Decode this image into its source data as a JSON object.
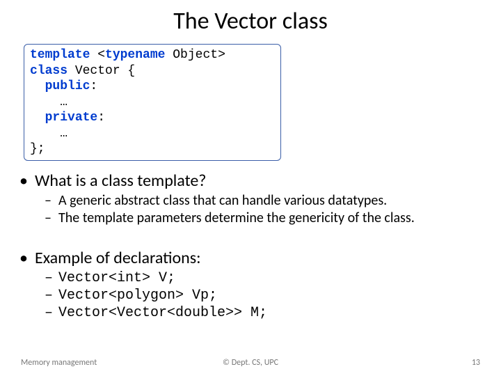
{
  "title": "The Vector class",
  "code": {
    "l1a": "template",
    "l1b": " <",
    "l1c": "typename",
    "l1d": " Object>",
    "l2a": "class",
    "l2b": " Vector {",
    "l3a": "  ",
    "l3b": "public",
    "l3c": ":",
    "l4": "    …",
    "l5a": "  ",
    "l5b": "private",
    "l5c": ":",
    "l6": "    …",
    "l7": "};"
  },
  "q1": "What is a class template?",
  "q1_sub": [
    "A generic abstract class that can handle various datatypes.",
    "The template parameters determine the genericity of the class."
  ],
  "q2": "Example of declarations:",
  "q2_sub": [
    "Vector<int> V;",
    "Vector<polygon> Vp;",
    "Vector<Vector<double>> M;"
  ],
  "footer": {
    "left": "Memory management",
    "center": "© Dept. CS, UPC",
    "right": "13"
  }
}
